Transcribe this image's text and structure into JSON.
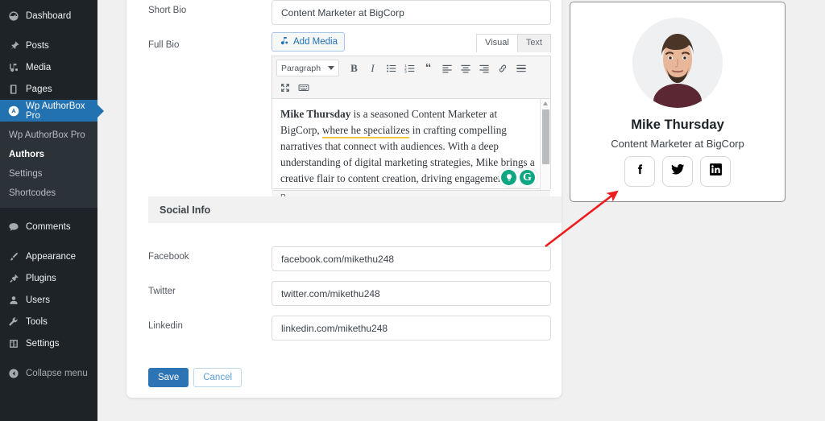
{
  "sidebar": {
    "items": [
      {
        "label": "Dashboard",
        "icon": "dashboard-icon"
      },
      {
        "label": "Posts",
        "icon": "pin-icon"
      },
      {
        "label": "Media",
        "icon": "media-icon"
      },
      {
        "label": "Pages",
        "icon": "pages-icon"
      },
      {
        "label": "Wp AuthorBox Pro",
        "icon": "authorbox-icon"
      },
      {
        "label": "Comments",
        "icon": "comments-icon"
      },
      {
        "label": "Appearance",
        "icon": "brush-icon"
      },
      {
        "label": "Plugins",
        "icon": "plugin-icon"
      },
      {
        "label": "Users",
        "icon": "users-icon"
      },
      {
        "label": "Tools",
        "icon": "wrench-icon"
      },
      {
        "label": "Settings",
        "icon": "settings-icon"
      }
    ],
    "submenu": [
      {
        "label": "Wp AuthorBox Pro",
        "current": false
      },
      {
        "label": "Authors",
        "current": true
      },
      {
        "label": "Settings",
        "current": false
      },
      {
        "label": "Shortcodes",
        "current": false
      }
    ],
    "collapse_label": "Collapse menu",
    "active_color": "#2271b1"
  },
  "form": {
    "short_bio": {
      "label": "Short Bio",
      "value": "Content Marketer at BigCorp",
      "placeholder": "Short Bio"
    },
    "full_bio": {
      "label": "Full Bio",
      "add_media_label": "Add Media",
      "tabs": [
        {
          "label": "Visual",
          "active": true
        },
        {
          "label": "Text",
          "active": false
        }
      ],
      "toolbar": {
        "format_select": "Paragraph",
        "buttons": [
          "bold-icon",
          "italic-icon",
          "bulleted-list-icon",
          "numbered-list-icon",
          "blockquote-icon",
          "align-left-icon",
          "align-center-icon",
          "align-right-icon",
          "link-icon",
          "read-more-icon",
          "fullscreen-icon",
          "keyboard-toolbar-icon"
        ]
      },
      "body_part1": "Mike Thursday",
      "body_part2": " is a seasoned Content Marketer at BigCorp, ",
      "body_link": "where he specializes",
      "body_part3": " in crafting compelling narratives that connect with audiences. With a deep understanding of digital marketing strategies, Mike brings a creative flair to content creation, driving engagement and brand growth for one of the industry's leading companies.",
      "status_path": "P",
      "grammarly": [
        "assistant-lightbulb-icon",
        "grammarly-logo-icon"
      ]
    }
  },
  "social_info": {
    "heading": "Social Info",
    "fields": [
      {
        "label": "Facebook",
        "value": "facebook.com/mikethu248",
        "name": "facebook-url-input"
      },
      {
        "label": "Twitter",
        "value": "twitter.com/mikethu248",
        "name": "twitter-url-input"
      },
      {
        "label": "Linkedin",
        "value": "linkedin.com/mikethu248",
        "name": "linkedin-url-input"
      }
    ]
  },
  "actions": {
    "save_label": "Save",
    "cancel_label": "Cancel",
    "save_color": "#2d74b5"
  },
  "preview": {
    "name": "Mike Thursday",
    "title": "Content Marketer at BigCorp",
    "avatar_alt": "author-portrait",
    "socials": [
      {
        "icon": "facebook-icon"
      },
      {
        "icon": "twitter-icon"
      },
      {
        "icon": "linkedin-icon"
      }
    ]
  },
  "annotation": {
    "arrow_color": "#ee1c1c",
    "points_to": "facebook-social-button"
  }
}
